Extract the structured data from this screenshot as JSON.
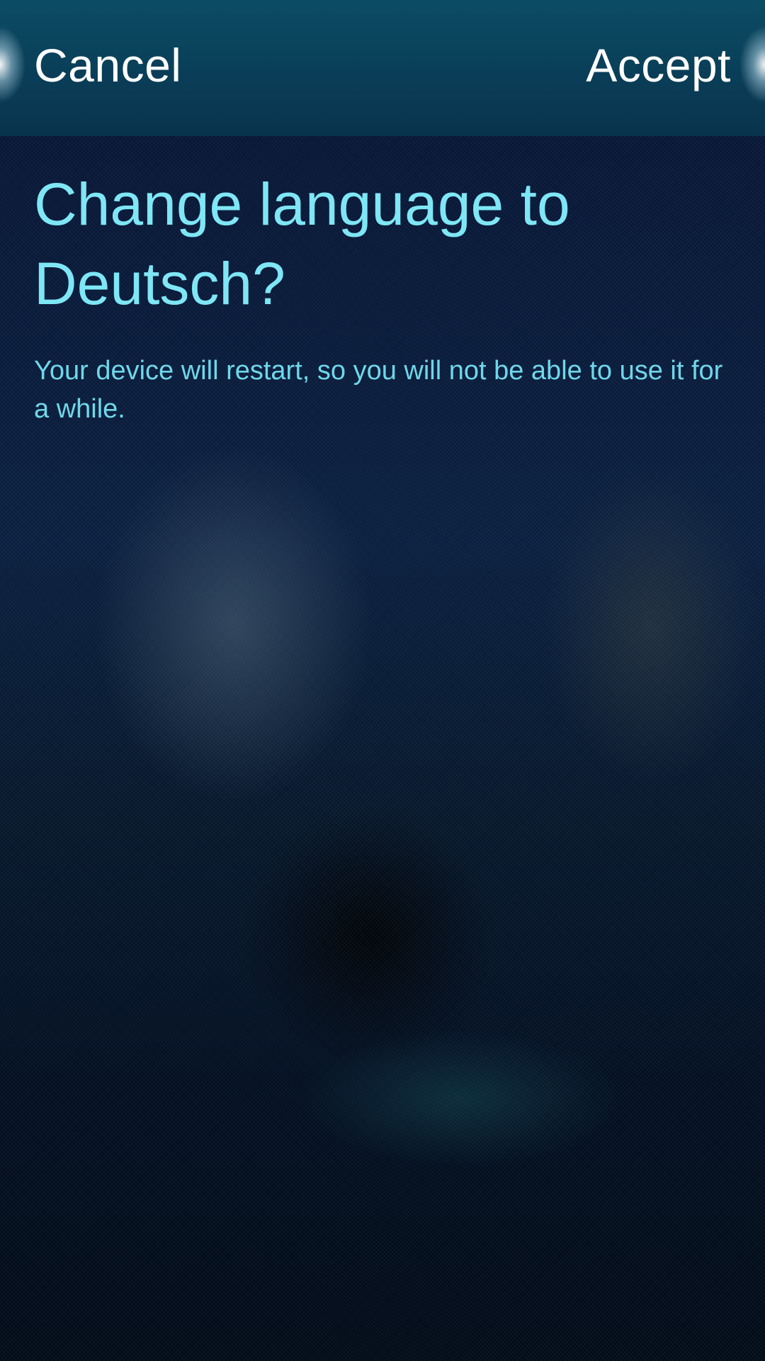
{
  "header": {
    "cancel_label": "Cancel",
    "accept_label": "Accept"
  },
  "dialog": {
    "title": "Change language to Deutsch?",
    "description": "Your device will restart, so you will not be able to use it for a while."
  },
  "colors": {
    "header_background": "#0a3e58",
    "title_text": "#7ee6f5",
    "description_text": "#6fd7ea",
    "header_text": "#ffffff",
    "background": "#071433"
  }
}
